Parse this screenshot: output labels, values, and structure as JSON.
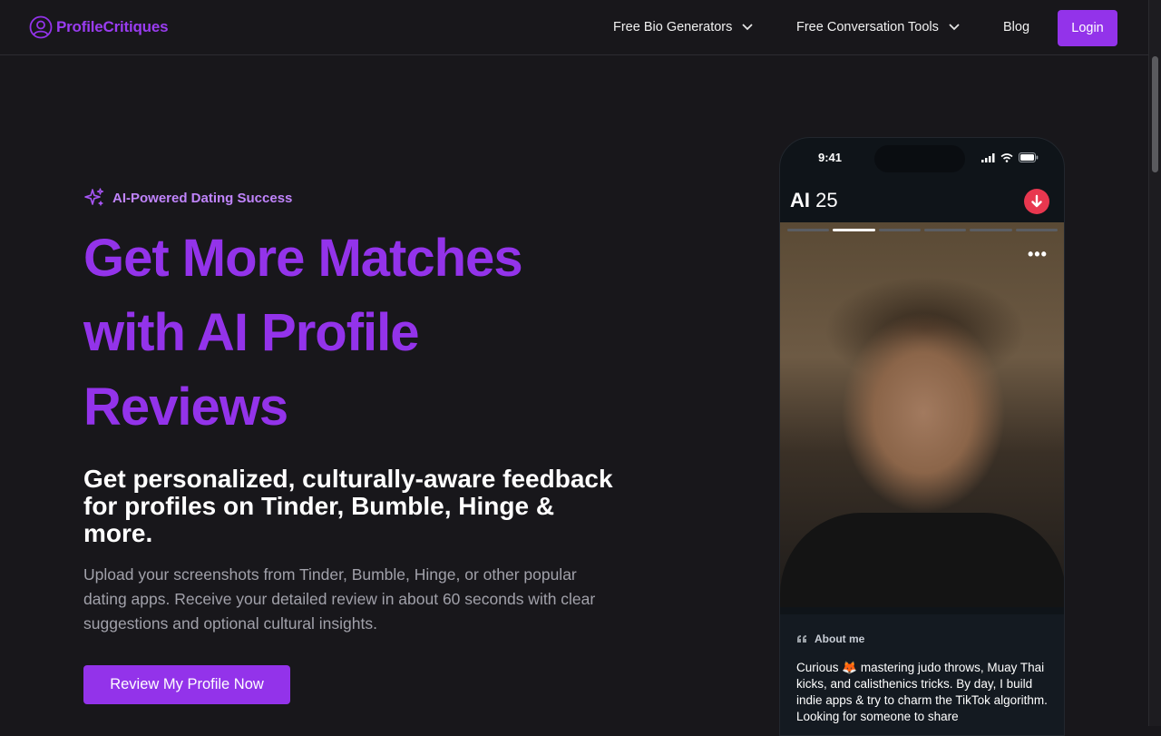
{
  "nav": {
    "logo_text": "ProfileCritiques",
    "items": [
      {
        "label": "Free Bio Generators"
      },
      {
        "label": "Free Conversation Tools"
      },
      {
        "label": "Blog"
      }
    ],
    "login_label": "Login"
  },
  "hero": {
    "badge": "AI-Powered Dating Success",
    "title": "Get More Matches with AI Profile Reviews",
    "subtitle": "Get personalized, culturally-aware feedback for profiles on Tinder, Bumble, Hinge & more.",
    "description": "Upload your screenshots from Tinder, Bumble, Hinge, or other popular dating apps. Receive your detailed review in about 60 seconds with clear suggestions and optional cultural insights.",
    "cta_label": "Review My Profile Now"
  },
  "phone": {
    "time": "9:41",
    "name": "AI",
    "age": "25",
    "about_heading": "About me",
    "about_text": "Curious 🦊 mastering judo throws, Muay Thai kicks, and calisthenics tricks. By day, I build indie apps & try to charm the TikTok algorithm. Looking for someone to share"
  },
  "colors": {
    "accent": "#9333ea",
    "badge": "#c084fc",
    "background": "#18171b"
  }
}
